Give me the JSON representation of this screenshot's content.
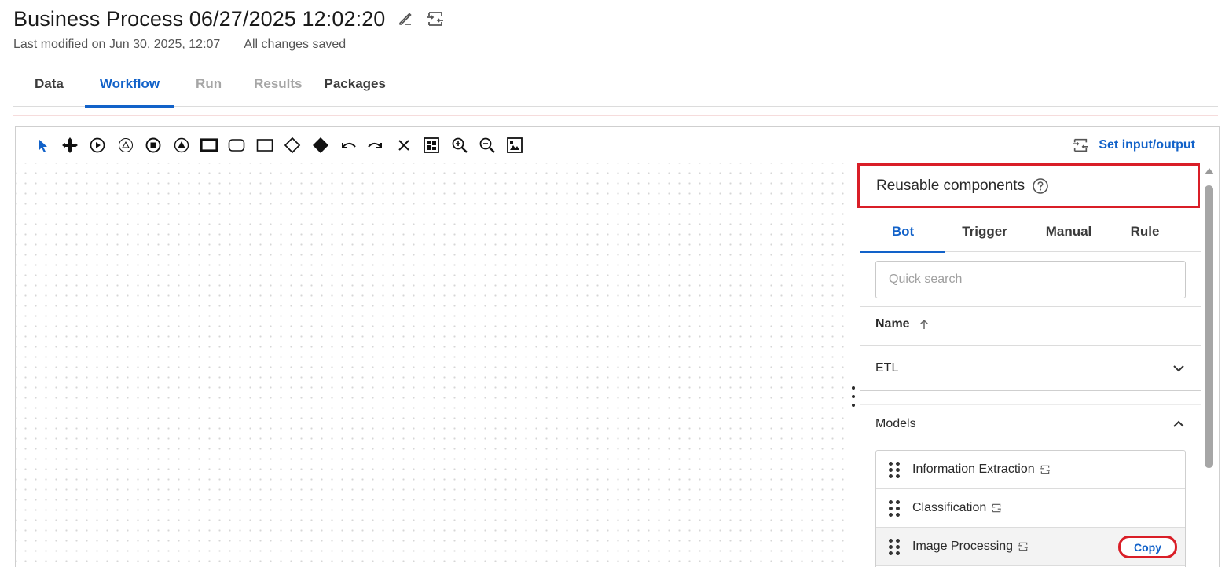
{
  "header": {
    "title": "Business Process 06/27/2025 12:02:20",
    "last_modified": "Last modified on Jun 30, 2025, 12:07",
    "save_status": "All changes saved",
    "edit_icon": "pencil-icon",
    "io_icon": "input-output-icon"
  },
  "tabs": [
    {
      "label": "Data",
      "state": "normal"
    },
    {
      "label": "Workflow",
      "state": "active"
    },
    {
      "label": "Run",
      "state": "disabled"
    },
    {
      "label": "Results",
      "state": "disabled"
    },
    {
      "label": "Packages",
      "state": "normal"
    }
  ],
  "toolbar": {
    "tools": [
      "pointer-icon",
      "pan-icon",
      "start-event-icon",
      "timer-event-icon",
      "end-event-icon",
      "escalation-event-icon",
      "bold-task-icon",
      "rounded-task-icon",
      "task-icon",
      "gateway-icon",
      "filled-gateway-icon",
      "undo-icon",
      "redo-icon",
      "delete-icon",
      "fit-layout-icon",
      "zoom-in-icon",
      "zoom-out-icon",
      "image-export-icon"
    ],
    "set_io_label": "Set input/output"
  },
  "panel": {
    "title": "Reusable components",
    "tabs": [
      {
        "label": "Bot",
        "active": true
      },
      {
        "label": "Trigger",
        "active": false
      },
      {
        "label": "Manual",
        "active": false
      },
      {
        "label": "Rule",
        "active": false
      }
    ],
    "search_placeholder": "Quick search",
    "sort_column": "Name",
    "groups": [
      {
        "label": "ETL",
        "expanded": false
      },
      {
        "label": "Models",
        "expanded": true
      }
    ],
    "models": [
      {
        "label": "Information Extraction"
      },
      {
        "label": "Classification"
      },
      {
        "label": "Image Processing"
      }
    ],
    "copy_label": "Copy"
  },
  "colors": {
    "accent": "#1262c9",
    "highlight": "#d91e27"
  }
}
